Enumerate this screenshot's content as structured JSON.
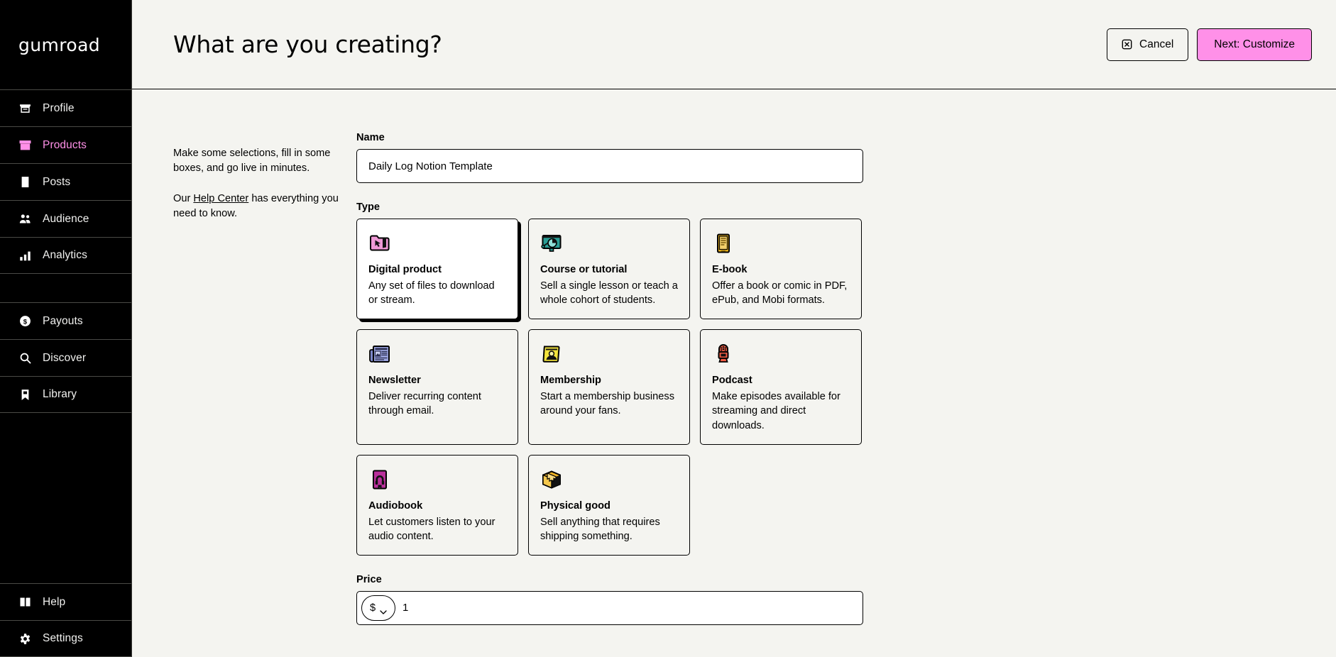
{
  "brand": {
    "logo_text": "gumroad"
  },
  "sidebar": {
    "items": [
      {
        "label": "Profile",
        "icon": "shop-icon",
        "active": false
      },
      {
        "label": "Products",
        "icon": "box-icon",
        "active": true
      },
      {
        "label": "Posts",
        "icon": "file-icon",
        "active": false
      },
      {
        "label": "Audience",
        "icon": "people-icon",
        "active": false
      },
      {
        "label": "Analytics",
        "icon": "bar-chart-icon",
        "active": false
      },
      {
        "label": "Payouts",
        "icon": "dollar-circle-icon",
        "active": false
      },
      {
        "label": "Discover",
        "icon": "search-icon",
        "active": false
      },
      {
        "label": "Library",
        "icon": "bookmark-icon",
        "active": false
      },
      {
        "label": "Help",
        "icon": "book-icon",
        "active": false
      },
      {
        "label": "Settings",
        "icon": "gear-icon",
        "active": false
      }
    ]
  },
  "header": {
    "title": "What are you creating?",
    "cancel_label": "Cancel",
    "cancel_icon": "x-square-icon",
    "next_label": "Next: Customize"
  },
  "intro": {
    "line1": "Make some selections, fill in some boxes, and go live in minutes.",
    "line2_before": "Our ",
    "help_link": "Help Center",
    "line2_after": " has everything you need to know."
  },
  "form": {
    "name_label": "Name",
    "name_value": "Daily Log Notion Template",
    "name_placeholder": "Name of product",
    "type_label": "Type",
    "price_label": "Price",
    "price_value": "1",
    "price_placeholder": "0",
    "currency_symbol": "$"
  },
  "product_types": [
    {
      "name": "Digital product",
      "desc": "Any set of files to download or stream.",
      "icon": "folder-cursor-icon",
      "selected": true
    },
    {
      "name": "Course or tutorial",
      "desc": "Sell a single lesson or teach a whole cohort of students.",
      "icon": "presentation-chart-icon",
      "selected": false
    },
    {
      "name": "E-book",
      "desc": "Offer a book or comic in PDF, ePub, and Mobi formats.",
      "icon": "ebook-icon",
      "selected": false
    },
    {
      "name": "Newsletter",
      "desc": "Deliver recurring content through email.",
      "icon": "newspaper-icon",
      "selected": false
    },
    {
      "name": "Membership",
      "desc": "Start a membership business around your fans.",
      "icon": "membership-card-icon",
      "selected": false
    },
    {
      "name": "Podcast",
      "desc": "Make episodes available for streaming and direct downloads.",
      "icon": "microphone-icon",
      "selected": false
    },
    {
      "name": "Audiobook",
      "desc": "Let customers listen to your audio content.",
      "icon": "audiobook-icon",
      "selected": false
    },
    {
      "name": "Physical good",
      "desc": "Sell anything that requires shipping something.",
      "icon": "package-box-icon",
      "selected": false
    }
  ],
  "colors": {
    "brand_pink": "#FF90E8",
    "background": "#F4F4F0",
    "sidebar": "#000000",
    "card_white": "#FFFFFF"
  }
}
